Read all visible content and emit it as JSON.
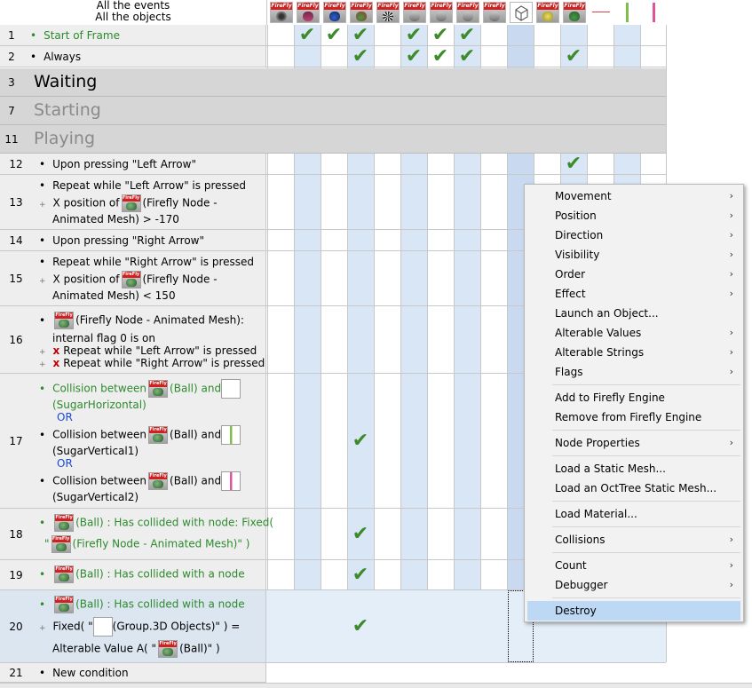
{
  "header": {
    "line1": "All the events",
    "line2": "All the objects"
  },
  "object_icons": [
    "firefly-camera-icon",
    "firefly-scene-icon",
    "firefly-sphere-icon",
    "firefly-ball-icon",
    "sphere-pattern-icon",
    "firefly-mesh-icon",
    "firefly-mesh-icon-2",
    "firefly-mesh-icon-3",
    "firefly-mesh-icon-4",
    "cube-group-icon",
    "firefly-light-icon",
    "firefly-node-icon",
    "horizontal-line-icon",
    "vertical-green-bar-icon",
    "vertical-pink-bar-icon"
  ],
  "groups": {
    "waiting": {
      "num": "3",
      "title": "Waiting"
    },
    "starting": {
      "num": "7",
      "title": "Starting"
    },
    "playing": {
      "num": "11",
      "title": "Playing"
    }
  },
  "rows": {
    "r1": {
      "num": "1",
      "text": "Start of Frame"
    },
    "r2": {
      "num": "2",
      "text": "Always"
    },
    "r12": {
      "num": "12",
      "text": "Upon pressing \"Left Arrow\""
    },
    "r13": {
      "num": "13",
      "l1": "Repeat while \"Left Arrow\" is pressed",
      "l2a": "X position of",
      "l2b": "(Firefly Node -",
      "l3": "Animated Mesh) > -170"
    },
    "r14": {
      "num": "14",
      "text": "Upon pressing \"Right Arrow\""
    },
    "r15": {
      "num": "15",
      "l1": "Repeat while \"Right Arrow\" is pressed",
      "l2a": "X position of",
      "l2b": "(Firefly Node -",
      "l3": "Animated Mesh) < 150"
    },
    "r16": {
      "num": "16",
      "l1": "(Firefly Node - Animated Mesh):",
      "l2": "internal flag 0 is on",
      "l3": "Repeat while \"Left Arrow\" is pressed",
      "l4": "Repeat while \"Right Arrow\" is pressed"
    },
    "r17": {
      "num": "17",
      "c1a": "Collision between",
      "c1b": "(Ball) and",
      "c1c": "(SugarHorizontal)",
      "or1": "OR",
      "c2a": "Collision between",
      "c2b": "(Ball) and",
      "c2c": "(SugarVertical1)",
      "or2": "OR",
      "c3a": "Collision between",
      "c3b": "(Ball) and",
      "c3c": "(SugarVertical2)"
    },
    "r18": {
      "num": "18",
      "l1": "(Ball) : Has collided with node: Fixed(",
      "l2a": "\"",
      "l2b": "(Firefly Node - Animated Mesh)\" )"
    },
    "r19": {
      "num": "19",
      "l1": "(Ball) : Has collided with a node"
    },
    "r20": {
      "num": "20",
      "l1": "(Ball) : Has collided with a node",
      "l2a": "Fixed( \"",
      "l2b": "(Group.3D Objects)\" ) =",
      "l3a": "Alterable Value A( \"",
      "l3b": "(Ball)\" )"
    },
    "r21": {
      "num": "21",
      "text": "New condition"
    }
  },
  "check_glyph": "✔",
  "x_glyph": "x",
  "context_menu": {
    "items": [
      {
        "label": "Movement",
        "submenu": true
      },
      {
        "label": "Position",
        "submenu": true
      },
      {
        "label": "Direction",
        "submenu": true
      },
      {
        "label": "Visibility",
        "submenu": true
      },
      {
        "label": "Order",
        "submenu": true
      },
      {
        "label": "Effect",
        "submenu": true
      },
      {
        "label": "Launch an Object...",
        "submenu": false
      },
      {
        "label": "Alterable Values",
        "submenu": true
      },
      {
        "label": "Alterable Strings",
        "submenu": true
      },
      {
        "label": "Flags",
        "submenu": true
      },
      {
        "label": "Add to Firefly Engine",
        "submenu": false
      },
      {
        "label": "Remove from Firefly Engine",
        "submenu": false
      },
      {
        "label": "Node Properties",
        "submenu": true
      },
      {
        "label": "Load a Static Mesh...",
        "submenu": false
      },
      {
        "label": "Load an OctTree Static Mesh...",
        "submenu": false
      },
      {
        "label": "Load Material...",
        "submenu": false
      },
      {
        "label": "Collisions",
        "submenu": true
      },
      {
        "label": "Count",
        "submenu": true
      },
      {
        "label": "Debugger",
        "submenu": true
      },
      {
        "label": "Destroy",
        "submenu": false,
        "selected": true
      }
    ],
    "arrow_glyph": "›"
  },
  "colors": {
    "accent_selected": "#bcd8f5",
    "check_green": "#3c8a2a",
    "firefly_red": "#d02020",
    "condition_green": "#2d8a2d",
    "or_blue": "#1a4ad4"
  }
}
